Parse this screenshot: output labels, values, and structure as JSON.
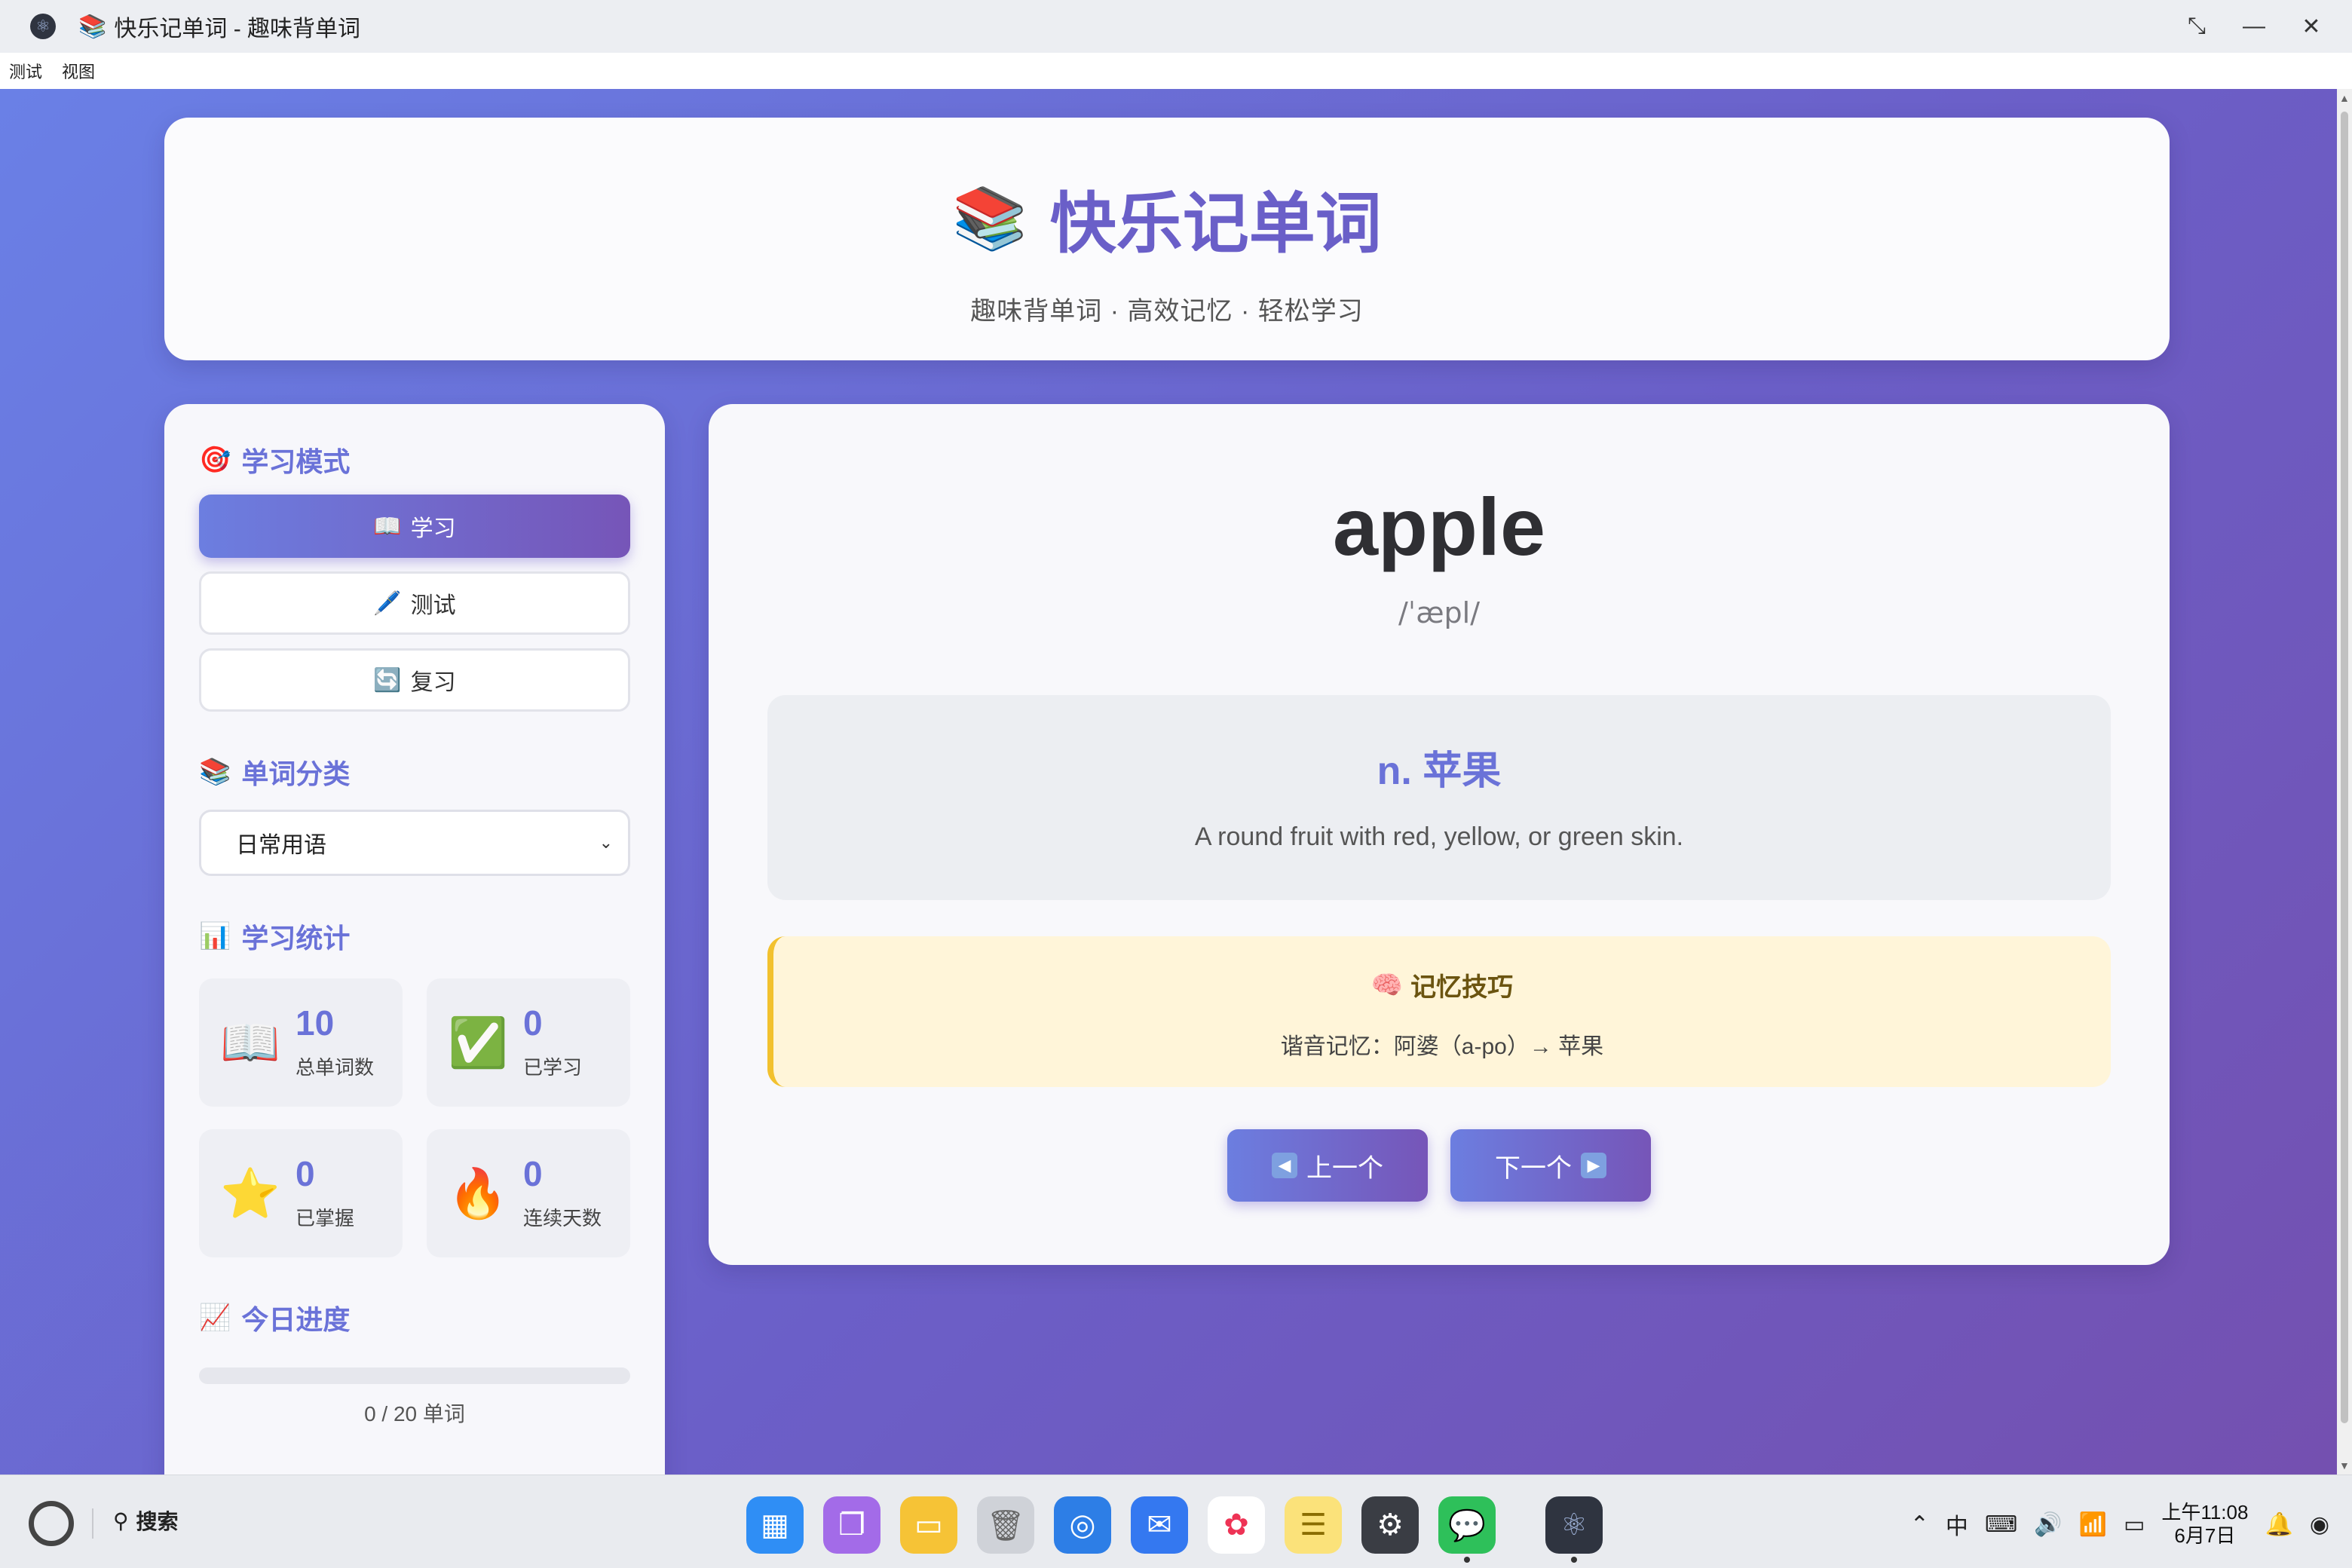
{
  "window": {
    "title_emoji": "📚",
    "title": "快乐记单词 - 趣味背单词",
    "controls": [
      "restore",
      "minimize",
      "close"
    ]
  },
  "menu": [
    "测试",
    "视图"
  ],
  "header": {
    "icon": "📚",
    "title": "快乐记单词",
    "subtitle": "趣味背单词 · 高效记忆 · 轻松学习"
  },
  "sidebar": {
    "mode_section": {
      "icon": "🎯",
      "title": "学习模式"
    },
    "modes": [
      {
        "icon": "📖",
        "label": "学习",
        "active": true
      },
      {
        "icon": "🖊️",
        "label": "测试",
        "active": false
      },
      {
        "icon": "🔄",
        "label": "复习",
        "active": false
      }
    ],
    "category_section": {
      "icon": "📚",
      "title": "单词分类"
    },
    "category_selected": "日常用语",
    "stats_section": {
      "icon": "📊",
      "title": "学习统计"
    },
    "stats": [
      {
        "icon": "📖",
        "value": "10",
        "label": "总单词数"
      },
      {
        "icon": "✅",
        "value": "0",
        "label": "已学习"
      },
      {
        "icon": "⭐",
        "value": "0",
        "label": "已掌握"
      },
      {
        "icon": "🔥",
        "value": "0",
        "label": "连续天数"
      }
    ],
    "progress_section": {
      "icon": "📈",
      "title": "今日进度"
    },
    "progress_fraction": 0,
    "progress_text": "0 / 20 单词"
  },
  "card": {
    "word": "apple",
    "phonetic": "/ˈæpl/",
    "meaning": "n. 苹果",
    "definition": "A round fruit with red, yellow, or green skin.",
    "tip_icon": "🧠",
    "tip_title": "记忆技巧",
    "tip_text": "谐音记忆：阿婆（a-po）→ 苹果",
    "prev_label": "上一个",
    "next_label": "下一个"
  },
  "taskbar": {
    "search_label": "搜索",
    "apps": [
      "launcher-icon",
      "multitask-icon",
      "files-icon",
      "trash-icon",
      "browser-icon",
      "mail-icon",
      "photos-icon",
      "notes-icon",
      "settings-icon",
      "wechat-icon",
      "electron-icon"
    ],
    "clock_time": "上午11:08",
    "clock_date": "6月7日"
  },
  "colors": {
    "accent": "#6a72d8",
    "gradient_start": "#6c7ee0",
    "gradient_end": "#7655b8",
    "tip_bg": "#fff5d9",
    "tip_border": "#f2c12e"
  }
}
